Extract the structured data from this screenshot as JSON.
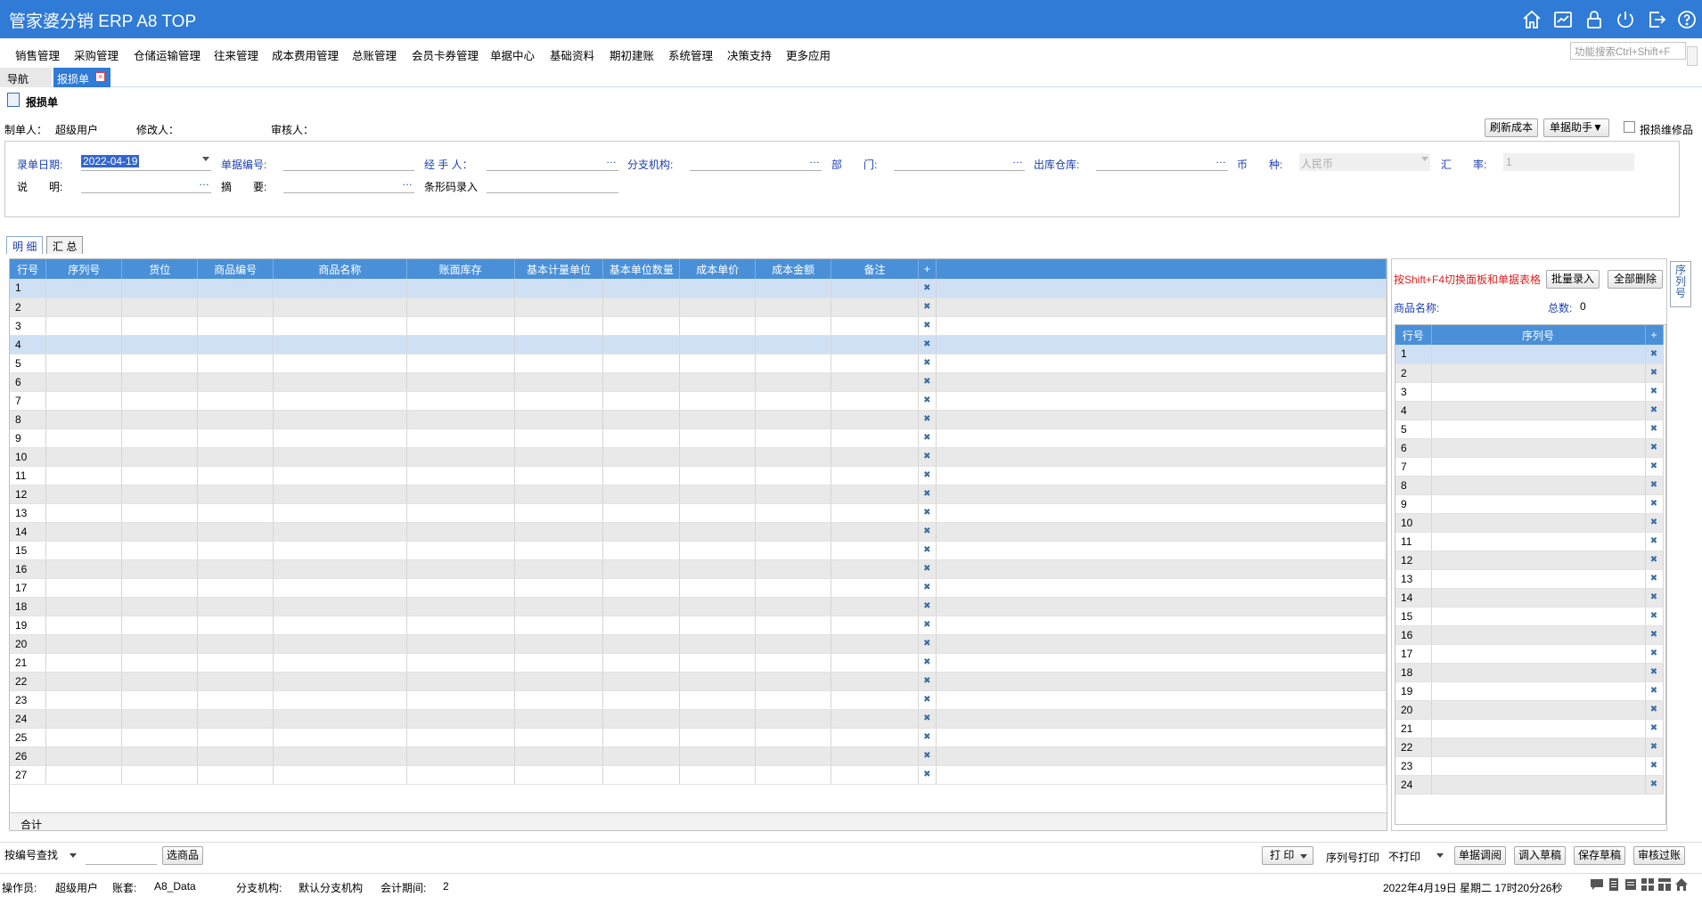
{
  "app": {
    "title": "管家婆分销 ERP A8 TOP"
  },
  "titlebar_icons": [
    "home-icon",
    "chart-icon",
    "lock-icon",
    "power-icon",
    "logout-icon",
    "help-icon"
  ],
  "menu": [
    "销售管理",
    "采购管理",
    "仓储运输管理",
    "往来管理",
    "成本费用管理",
    "总账管理",
    "会员卡券管理",
    "单据中心",
    "基础资料",
    "期初建账",
    "系统管理",
    "决策支持",
    "更多应用"
  ],
  "search": {
    "placeholder": "功能搜索Ctrl+Shift+F"
  },
  "tabs": {
    "nav": "导航",
    "doc": "报损单"
  },
  "form": {
    "title": "报损单",
    "maker_label": "制单人：",
    "maker_value": "超级用户",
    "modifier_label": "修改人：",
    "auditor_label": "审核人：",
    "refresh_cost": "刷新成本",
    "doc_helper": "单据助手▼",
    "damaged_repair": "报损维修品",
    "date_label": "录单日期:",
    "date_value": "2022-04-19",
    "doc_no_label": "单据编号:",
    "handler_label": "经 手 人：",
    "branch_label": "分支机构:",
    "dept_label": "部　　门:",
    "warehouse_label": "出库仓库:",
    "currency_label": "币　　种:",
    "currency_value": "人民币",
    "rate_label": "汇　　率:",
    "rate_value": "1",
    "desc_label": "说　　明:",
    "summary_label": "摘　　要:",
    "barcode_label": "条形码录入"
  },
  "subtabs": {
    "detail": "明 细",
    "summary": "汇 总"
  },
  "grid": {
    "columns": [
      "行号",
      "序列号",
      "货位",
      "商品编号",
      "商品名称",
      "账面库存",
      "基本计量单位",
      "基本单位数量",
      "成本单价",
      "成本金额",
      "备注",
      "+"
    ],
    "rows": [
      "1",
      "2",
      "3",
      "4",
      "5",
      "6",
      "7",
      "8",
      "9",
      "10",
      "11",
      "12",
      "13",
      "14",
      "15",
      "16",
      "17",
      "18",
      "19",
      "20",
      "21",
      "22",
      "23",
      "24",
      "25",
      "26",
      "27"
    ],
    "total_label": "合计"
  },
  "serial_panel": {
    "hint": "按Shift+F4切换面板和单据表格",
    "batch_entry": "批量录入",
    "delete_all": "全部删除",
    "product_name_label": "商品名称:",
    "total_label": "总数:",
    "total_value": "0",
    "columns": [
      "行号",
      "序列号",
      "+"
    ],
    "rows": [
      "1",
      "2",
      "3",
      "4",
      "5",
      "6",
      "7",
      "8",
      "9",
      "10",
      "11",
      "12",
      "13",
      "14",
      "15",
      "16",
      "17",
      "18",
      "19",
      "20",
      "21",
      "22",
      "23",
      "24"
    ],
    "side_tab": "序列号"
  },
  "bottom": {
    "lookup_select": "按编号查找",
    "select_goods": "选商品",
    "print": "打 印",
    "serial_print_label": "序列号打印",
    "serial_print_value": "不打印",
    "doc_transfer": "单据调阅",
    "load_draft": "调入草稿",
    "save_draft": "保存草稿",
    "audit_post": "审核过账"
  },
  "status": {
    "operator_label": "操作员:",
    "operator_value": "超级用户",
    "account_label": "账套:",
    "account_value": "A8_Data",
    "branch_label": "分支机构:",
    "branch_value": "默认分支机构",
    "period_label": "会计期间:",
    "period_value": "2",
    "datetime": "2022年4月19日  星期二  17时20分26秒"
  }
}
